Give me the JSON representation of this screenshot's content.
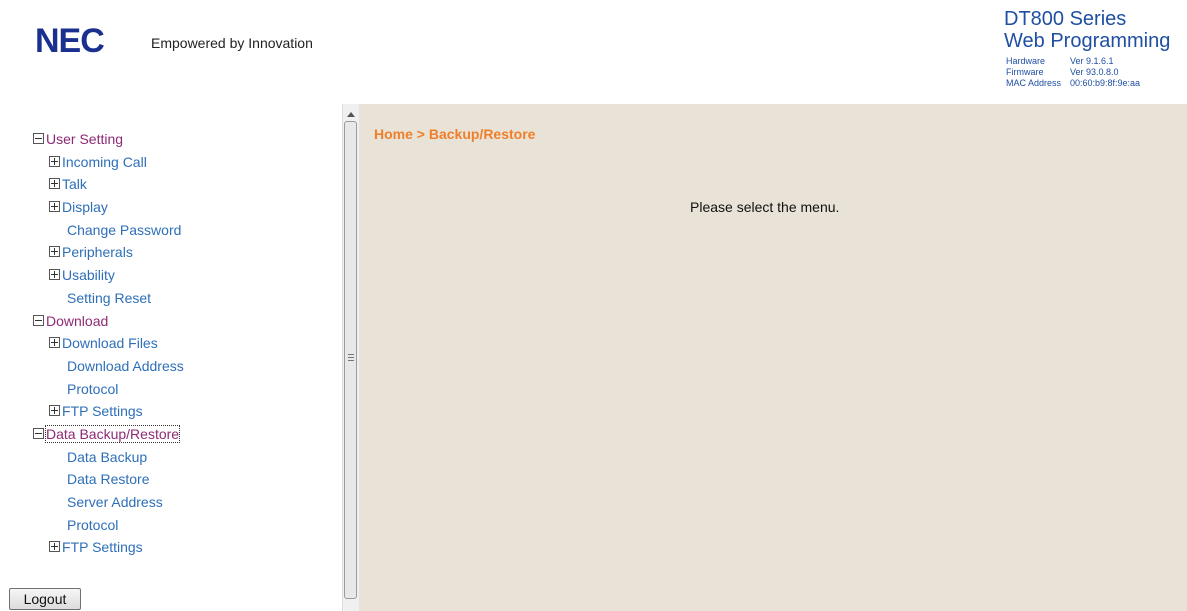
{
  "header": {
    "logo": "NEC",
    "tagline": "Empowered by Innovation",
    "product_line1": "DT800 Series",
    "product_line2": "Web Programming",
    "hardware_label": "Hardware",
    "hardware_value": "Ver 9.1.6.1",
    "firmware_label": "Firmware",
    "firmware_value": "Ver 93.0.8.0",
    "mac_label": "MAC Address",
    "mac_value": "00:60:b9:8f:9e:aa"
  },
  "menu": {
    "user_setting": "User Setting",
    "incoming_call": "Incoming Call",
    "talk": "Talk",
    "display": "Display",
    "change_password": "Change Password",
    "peripherals": "Peripherals",
    "usability": "Usability",
    "setting_reset": "Setting Reset",
    "download": "Download",
    "download_files": "Download Files",
    "download_address": "Download Address",
    "protocol": "Protocol",
    "ftp_settings": "FTP Settings",
    "data_backup_restore": "Data Backup/Restore",
    "data_backup": "Data Backup",
    "data_restore": "Data Restore",
    "server_address": "Server Address",
    "protocol2": "Protocol",
    "ftp_settings2": "FTP Settings"
  },
  "logout_label": "Logout",
  "main": {
    "breadcrumb": "Home > Backup/Restore",
    "message": "Please select the menu."
  },
  "colors": {
    "section": "#8e2a75",
    "item": "#2e6fb8",
    "breadcrumb": "#ef7f2a",
    "main_bg": "#e8e3d6",
    "brand": "#1b2f8f"
  }
}
